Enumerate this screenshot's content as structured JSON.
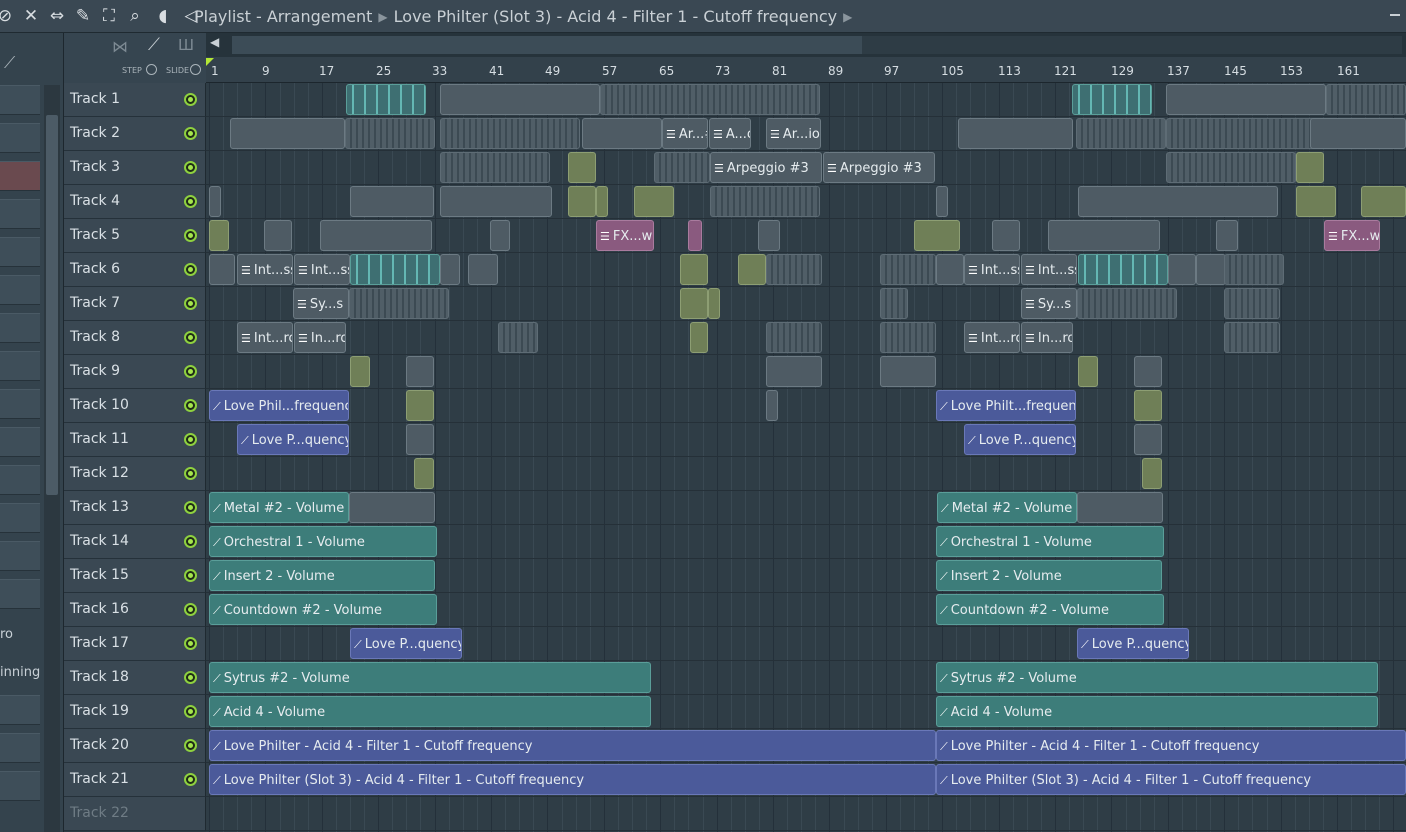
{
  "window": {
    "breadcrumb": [
      "Playlist - Arrangement",
      "Love Philter (Slot 3) - Acid 4 - Filter 1 - Cutoff frequency"
    ]
  },
  "toolbar": {
    "step_label": "STEP",
    "slide_label": "SLIDE"
  },
  "browser": {
    "labels": [
      "ro",
      "inning"
    ]
  },
  "ruler": {
    "ticks": [
      "1",
      "9",
      "17",
      "25",
      "33",
      "41",
      "49",
      "57",
      "65",
      "73",
      "81",
      "89",
      "97",
      "105",
      "113",
      "121",
      "129",
      "137",
      "145",
      "153",
      "161"
    ]
  },
  "tracks": [
    "Track 1",
    "Track 2",
    "Track 3",
    "Track 4",
    "Track 5",
    "Track 6",
    "Track 7",
    "Track 8",
    "Track 9",
    "Track 10",
    "Track 11",
    "Track 12",
    "Track 13",
    "Track 14",
    "Track 15",
    "Track 16",
    "Track 17",
    "Track 18",
    "Track 19",
    "Track 20",
    "Track 21",
    "Track 22"
  ],
  "clips": {
    "t2_ar2": "Ar...#2",
    "t2_ao": "A...o",
    "t2_ario": "Ar...io",
    "t3_arp1": "Arpeggio #3",
    "t3_arp2": "Arpeggio #3",
    "t5_fx1": "FX...wl",
    "t5_fx2": "FX...wl",
    "t6_int1": "Int...ss",
    "t6_int2": "Int...ss",
    "t6_int3": "Int...ss",
    "t6_int4": "Int...ss",
    "t7_sy1": "Sy...s",
    "t7_sy2": "Sy...s",
    "t8_int1": "Int...ro",
    "t8_in1": "In...ro",
    "t8_int2": "Int...ro",
    "t8_in2": "In...ro",
    "t10_a": "Love Phil...frequency",
    "t10_b": "Love Philt...frequency",
    "t11_a": "Love P...quency",
    "t11_b": "Love P...quency",
    "t13_a": "Metal #2 - Volume",
    "t13_b": "Metal #2 - Volume",
    "t14_a": "Orchestral 1 - Volume",
    "t14_b": "Orchestral 1 - Volume",
    "t15_a": "Insert 2 - Volume",
    "t15_b": "Insert 2 - Volume",
    "t16_a": "Countdown #2 - Volume",
    "t16_b": "Countdown #2 - Volume",
    "t17_a": "Love P...quency",
    "t17_b": "Love P...quency",
    "t18_a": "Sytrus #2 - Volume",
    "t18_b": "Sytrus #2 - Volume",
    "t19_a": "Acid 4 - Volume",
    "t19_b": "Acid 4 - Volume",
    "t20_a": "Love Philter - Acid 4 - Filter 1 - Cutoff frequency",
    "t20_b": "Love Philter - Acid 4 - Filter 1 - Cutoff frequency",
    "t21_a": "Love Philter (Slot 3) - Acid 4 - Filter 1 - Cutoff frequency",
    "t21_b": "Love Philter (Slot 3) - Acid 4 - Filter 1 - Cutoff frequency"
  },
  "colors": {
    "accent_green": "#8ed13f",
    "automation_clip": "#4b5a9a",
    "teal_clip": "#3d7d7a",
    "pattern_clip": "#4e5b64"
  }
}
